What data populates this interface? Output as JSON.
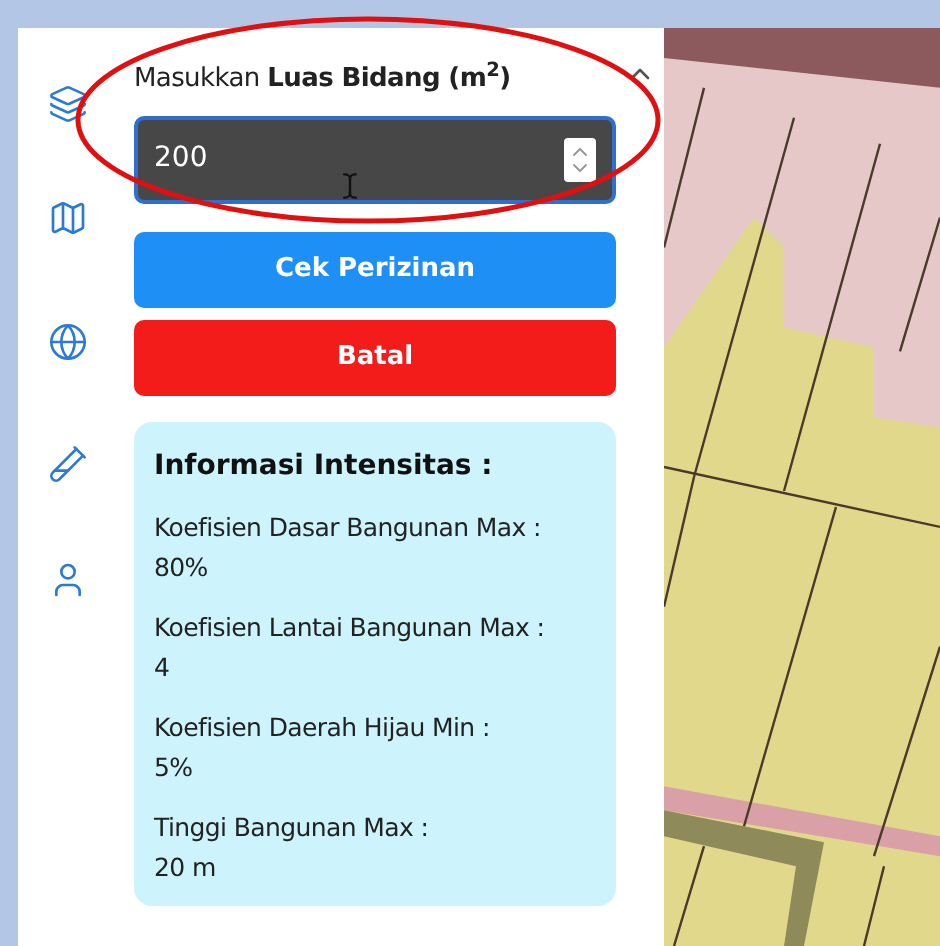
{
  "form": {
    "label": "Masukkan **Luas Bidang (m$^{2}$)**",
    "input": {
      "value": "200"
    }
  },
  "buttons": [
    {
      "label": "Cek Perizinan",
      "kind": "primary"
    },
    {
      "label": "Batal",
      "kind": "danger"
    }
  ],
  "info": {
    "title": "Informasi Intensitas :",
    "items": [
      {
        "label": "Koefisien Dasar Bangunan Max :",
        "value": "80%"
      },
      {
        "label": "Koefisien Lantai Bangunan Max :",
        "value": "4"
      },
      {
        "label": "Koefisien Daerah Hijau Min :",
        "value": "5%"
      },
      {
        "label": "Tinggi Bangunan Max :",
        "value": "20 m"
      }
    ]
  }
}
